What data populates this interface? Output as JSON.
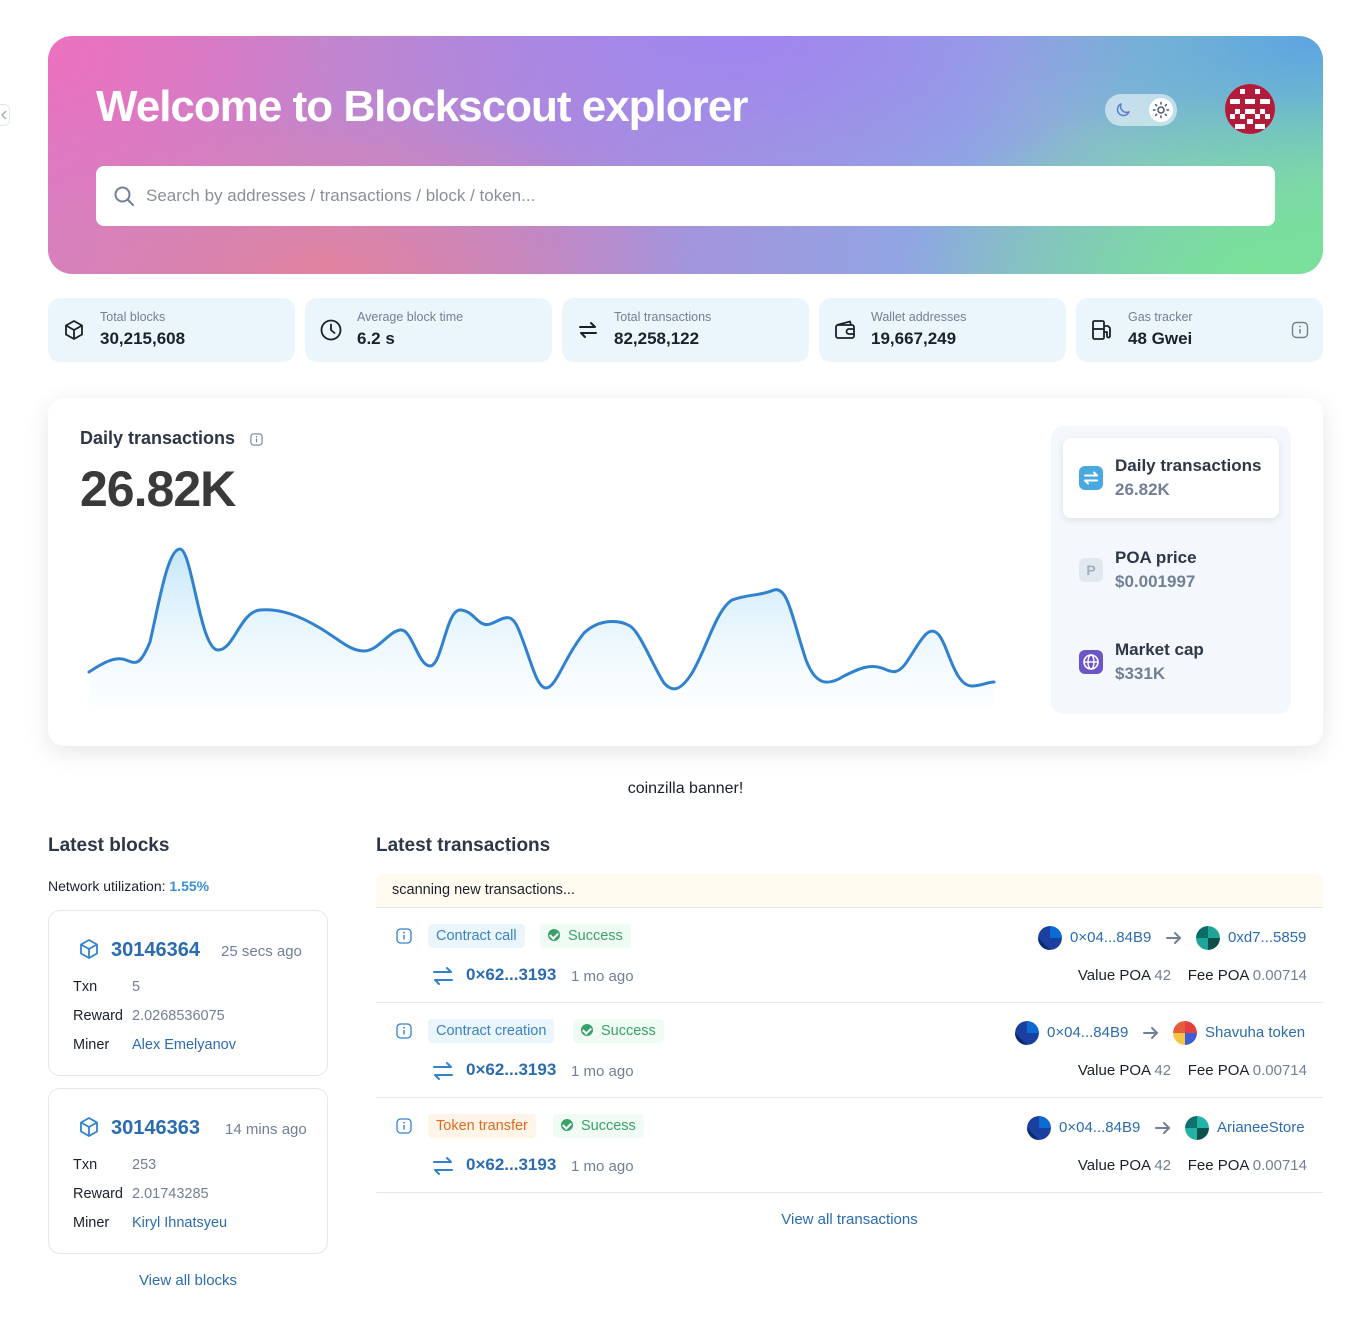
{
  "hero": {
    "title": "Welcome to Blockscout explorer",
    "search_placeholder": "Search by addresses / transactions / block / token..."
  },
  "stats": [
    {
      "label": "Total blocks",
      "value": "30,215,608",
      "icon": "cube-icon"
    },
    {
      "label": "Average block time",
      "value": "6.2 s",
      "icon": "clock-icon"
    },
    {
      "label": "Total transactions",
      "value": "82,258,122",
      "icon": "transactions-icon"
    },
    {
      "label": "Wallet addresses",
      "value": "19,667,249",
      "icon": "wallet-icon"
    },
    {
      "label": "Gas tracker",
      "value": "48 Gwei",
      "icon": "gas-pump-icon"
    }
  ],
  "chart": {
    "title": "Daily transactions",
    "value": "26.82K",
    "line_color": "#3182ce",
    "side": [
      {
        "title": "Daily transactions",
        "value": "26.82K",
        "icon": "swap-icon",
        "active": true
      },
      {
        "title": "POA price",
        "value": "$0.001997",
        "icon": "token-p-icon",
        "active": false
      },
      {
        "title": "Market cap",
        "value": "$331K",
        "icon": "globe-icon",
        "active": false
      }
    ]
  },
  "banner": "coinzilla banner!",
  "latest_blocks": {
    "title": "Latest blocks",
    "utilization_label": "Network utilization:",
    "utilization_value": "1.55%",
    "blocks": [
      {
        "number": "30146364",
        "time": "25 secs ago",
        "txn": "5",
        "reward": "2.0268536075",
        "miner": "Alex Emelyanov"
      },
      {
        "number": "30146363",
        "time": "14 mins ago",
        "txn": "253",
        "reward": "2.01743285",
        "miner": "Kiryl Ihnatsyeu"
      }
    ],
    "labels": {
      "txn": "Txn",
      "reward": "Reward",
      "miner": "Miner"
    },
    "view_all": "View all blocks"
  },
  "latest_transactions": {
    "title": "Latest transactions",
    "scanning": "scanning new transactions...",
    "items": [
      {
        "type": "Contract call",
        "status": "Success",
        "hash": "0×62...3193",
        "time": "1 mo ago",
        "from": "0×04...84B9",
        "to": "0xd7...5859",
        "value_label": "Value POA",
        "value": "42",
        "fee_label": "Fee POA",
        "fee": "0.00714"
      },
      {
        "type": "Contract creation",
        "status": "Success",
        "hash": "0×62...3193",
        "time": "1 mo ago",
        "from": "0×04...84B9",
        "to": "Shavuha token",
        "value_label": "Value POA",
        "value": "42",
        "fee_label": "Fee POA",
        "fee": "0.00714"
      },
      {
        "type": "Token transfer",
        "status": "Success",
        "hash": "0×62...3193",
        "time": "1 mo ago",
        "from": "0×04...84B9",
        "to": "ArianeeStore",
        "value_label": "Value POA",
        "value": "42",
        "fee_label": "Fee POA",
        "fee": "0.00714"
      }
    ],
    "view_all": "View all transactions"
  },
  "colors": {
    "accent": "#2b6cb0",
    "success": "#38a169",
    "stat_bg": "#ebf5fc"
  }
}
